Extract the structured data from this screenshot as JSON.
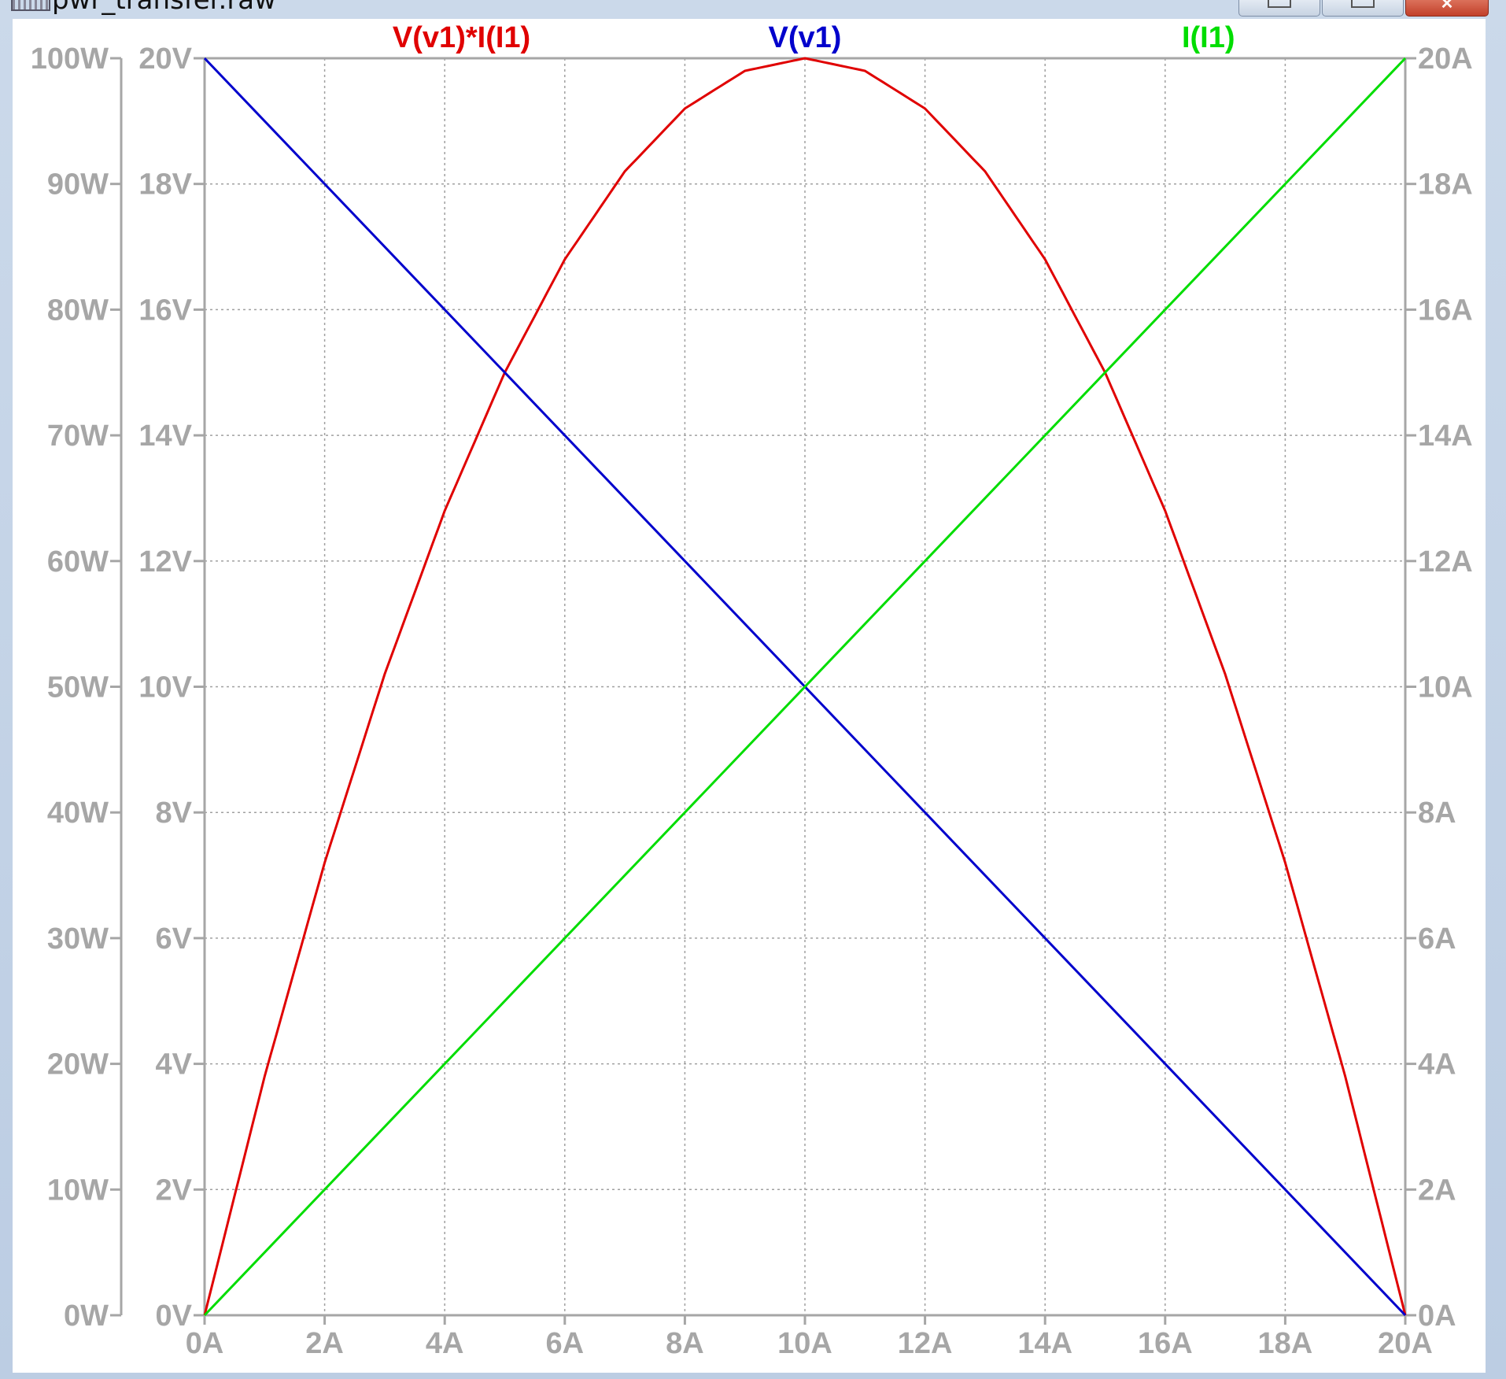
{
  "window": {
    "title": "pwr_transfer.raw",
    "icons": {
      "app": "waveform-file-icon",
      "minimize": "minimize-icon",
      "maximize": "maximize-icon",
      "close": "close-icon"
    }
  },
  "chart_data": {
    "type": "line",
    "x": {
      "min": 0,
      "max": 20,
      "ticks": [
        0,
        2,
        4,
        6,
        8,
        10,
        12,
        14,
        16,
        18,
        20
      ],
      "tick_labels": [
        "0A",
        "2A",
        "4A",
        "6A",
        "8A",
        "10A",
        "12A",
        "14A",
        "16A",
        "18A",
        "20A"
      ]
    },
    "axes": {
      "power": {
        "min": 0,
        "max": 100,
        "tick_labels": [
          "0W",
          "10W",
          "20W",
          "30W",
          "40W",
          "50W",
          "60W",
          "70W",
          "80W",
          "90W",
          "100W"
        ]
      },
      "voltage": {
        "min": 0,
        "max": 20,
        "tick_labels": [
          "0V",
          "2V",
          "4V",
          "6V",
          "8V",
          "10V",
          "12V",
          "14V",
          "16V",
          "18V",
          "20V"
        ]
      },
      "current": {
        "min": 0,
        "max": 20,
        "tick_labels": [
          "0A",
          "2A",
          "4A",
          "6A",
          "8A",
          "10A",
          "12A",
          "14A",
          "16A",
          "18A",
          "20A"
        ]
      }
    },
    "grid": true,
    "series": [
      {
        "name": "V(v1)*I(I1)",
        "axis": "power",
        "color": "#e00000",
        "x": [
          0,
          1,
          2,
          3,
          4,
          5,
          6,
          7,
          8,
          9,
          10,
          11,
          12,
          13,
          14,
          15,
          16,
          17,
          18,
          19,
          20
        ],
        "values": [
          0,
          19,
          36,
          51,
          64,
          75,
          84,
          91,
          96,
          99,
          100,
          99,
          96,
          91,
          84,
          75,
          64,
          51,
          36,
          19,
          0
        ]
      },
      {
        "name": "V(v1)",
        "axis": "voltage",
        "color": "#0000cc",
        "x": [
          0,
          20
        ],
        "values": [
          20,
          0
        ]
      },
      {
        "name": "I(I1)",
        "axis": "current",
        "color": "#00dd00",
        "x": [
          0,
          20
        ],
        "values": [
          0,
          20
        ]
      }
    ]
  }
}
